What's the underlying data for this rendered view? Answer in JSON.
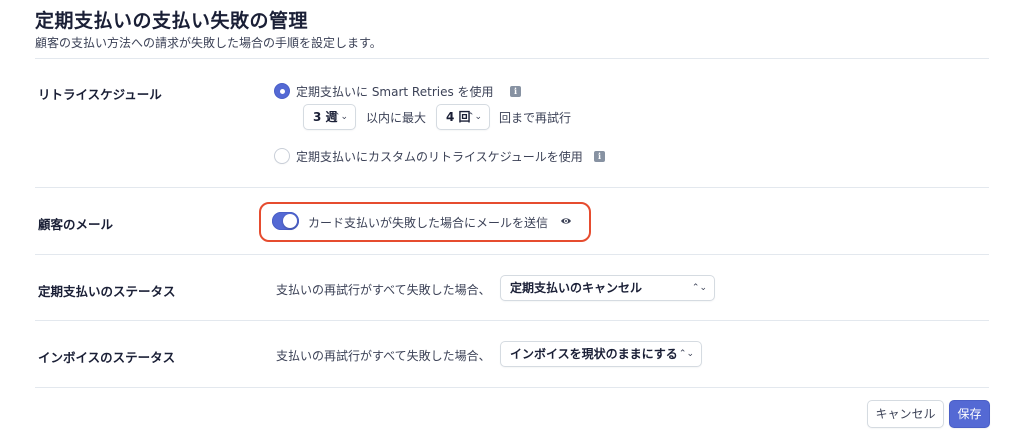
{
  "header": {
    "title": "定期支払いの支払い失敗の管理",
    "subtitle": "顧客の支払い方法への請求が失敗した場合の手順を設定します。"
  },
  "retry_schedule": {
    "label": "リトライスケジュール",
    "option_smart": {
      "label": "定期支払いに Smart Retries を使用",
      "selected": true
    },
    "period_select": "3 週",
    "mid_text": "以内に最大",
    "count_select": "4 回",
    "suffix_text": "回まで再試行",
    "option_custom": {
      "label": "定期支払いにカスタムのリトライスケジュールを使用",
      "selected": false
    }
  },
  "customer_email": {
    "label": "顧客のメール",
    "toggle_on": true,
    "toggle_label": "カード支払いが失敗した場合にメールを送信"
  },
  "subscription_status": {
    "label": "定期支払いのステータス",
    "condition": "支払いの再試行がすべて失敗した場合、",
    "select_value": "定期支払いのキャンセル"
  },
  "invoice_status": {
    "label": "インボイスのステータス",
    "condition": "支払いの再試行がすべて失敗した場合、",
    "select_value": "インボイスを現状のままにする"
  },
  "footer": {
    "cancel_label": "キャンセル",
    "save_label": "保存"
  },
  "colors": {
    "accent": "#5469d4",
    "highlight": "#e64c2f"
  },
  "icons": {
    "info": "info-icon",
    "eye": "eye-icon",
    "chevron": "chevron-up-down-icon"
  }
}
